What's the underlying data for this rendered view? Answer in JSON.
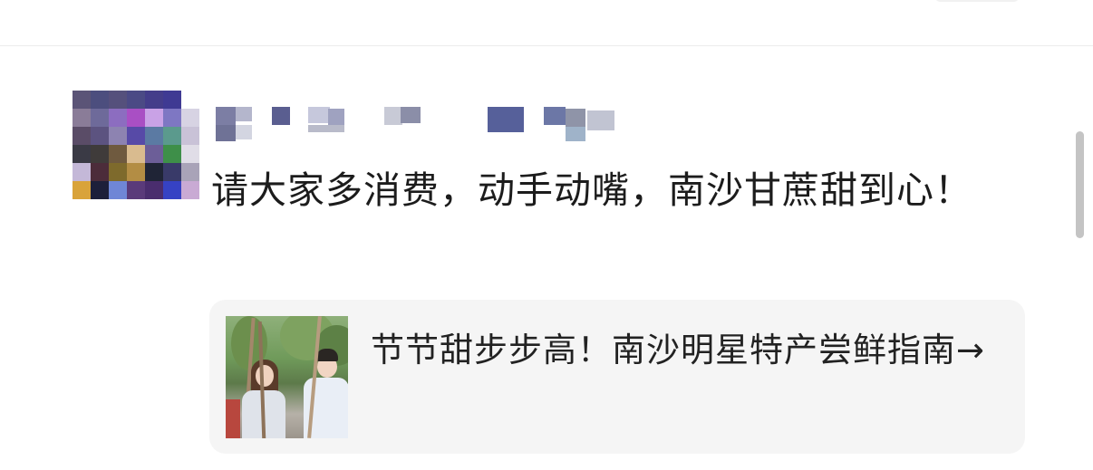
{
  "comment": {
    "text": "请大家多消费，动手动嘴，南沙甘蔗甜到心！"
  },
  "link_card": {
    "title": "节节甜步步高！南沙明星特产尝鲜指南",
    "arrow": "→",
    "thumbnail_icon": "photo-thumbnail"
  },
  "avatar": {
    "pixel_colors": [
      "#5b5477",
      "#4c4e7e",
      "#55507c",
      "#4b4a85",
      "#443d8a",
      "#3f3a93",
      "#ffffff",
      "#8a7c98",
      "#6e6a9a",
      "#8c6dc0",
      "#a94fc4",
      "#c9a2e6",
      "#7e77c3",
      "#d7d3e3",
      "#5a4c67",
      "#5c5380",
      "#8d83b1",
      "#574aa7",
      "#5b7aa3",
      "#5b9a8d",
      "#c9c2d7",
      "#3a3a45",
      "#3f3b3a",
      "#6f5a3f",
      "#d9bb8f",
      "#6c5e98",
      "#3e8f49",
      "#e0dde7",
      "#c4b8d8",
      "#4c2c3a",
      "#7e6a2c",
      "#b38d44",
      "#1f2436",
      "#393a69",
      "#a9a3b8",
      "#d9a33a",
      "#1d1f3a",
      "#6f86d6",
      "#5a3a7a",
      "#4a2d6e",
      "#3642c4",
      "#c9aad4"
    ]
  },
  "username": {
    "blocks": [
      {
        "color": "#7c7ea4"
      },
      {
        "color": "#b4b6cc"
      },
      {
        "color": "#5a5e90"
      },
      {
        "color": "#c6c8dc"
      },
      {
        "color": "#9fa2c0"
      },
      {
        "color": "#c8cad6"
      },
      {
        "color": "#8b8ea8"
      },
      {
        "color": "#6f7296"
      },
      {
        "color": "#d3d5e1"
      },
      {
        "color": "#b9bbca"
      },
      {
        "color": "#56609a"
      },
      {
        "color": "#6c77a6"
      },
      {
        "color": "#8f94a8"
      },
      {
        "color": "#9fb3c9"
      },
      {
        "color": "#c1c4d2"
      }
    ]
  }
}
